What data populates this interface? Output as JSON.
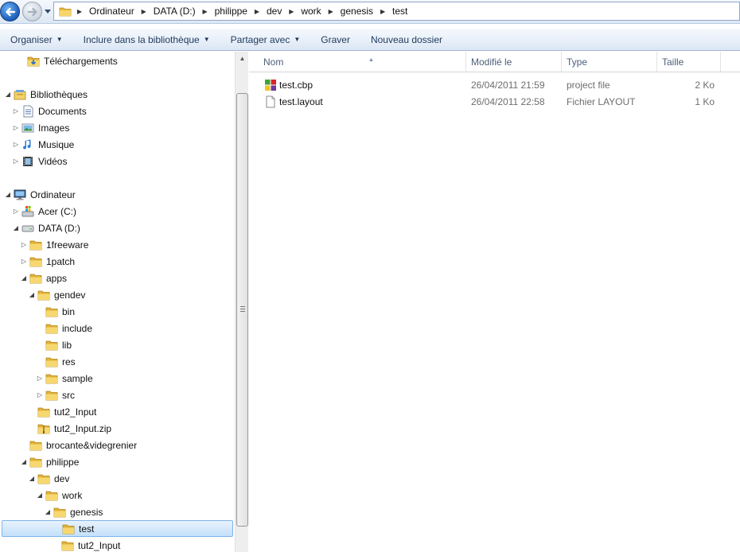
{
  "address_bar": {
    "crumbs": [
      "Ordinateur",
      "DATA (D:)",
      "philippe",
      "dev",
      "work",
      "genesis",
      "test"
    ]
  },
  "toolbar": {
    "organize": "Organiser",
    "include_library": "Inclure dans la bibliothèque",
    "share_with": "Partager avec",
    "burn": "Graver",
    "new_folder": "Nouveau dossier"
  },
  "nav_tree": [
    {
      "label": "Téléchargements",
      "icon": "downloads-folder-icon",
      "expander": "none"
    },
    {
      "label": "Bibliothèques",
      "icon": "libraries-icon",
      "expander": "expanded"
    },
    {
      "label": "Documents",
      "icon": "documents-library-icon",
      "expander": "collapsed"
    },
    {
      "label": "Images",
      "icon": "pictures-library-icon",
      "expander": "collapsed"
    },
    {
      "label": "Musique",
      "icon": "music-library-icon",
      "expander": "collapsed"
    },
    {
      "label": "Vidéos",
      "icon": "videos-library-icon",
      "expander": "collapsed"
    },
    {
      "label": "Ordinateur",
      "icon": "computer-icon",
      "expander": "expanded"
    },
    {
      "label": "Acer (C:)",
      "icon": "system-drive-icon",
      "expander": "collapsed"
    },
    {
      "label": "DATA (D:)",
      "icon": "hard-drive-icon",
      "expander": "expanded"
    },
    {
      "label": "1freeware",
      "icon": "folder-icon",
      "expander": "collapsed"
    },
    {
      "label": "1patch",
      "icon": "folder-icon",
      "expander": "collapsed"
    },
    {
      "label": "apps",
      "icon": "folder-icon",
      "expander": "expanded"
    },
    {
      "label": "gendev",
      "icon": "folder-icon",
      "expander": "expanded"
    },
    {
      "label": "bin",
      "icon": "folder-icon",
      "expander": "none"
    },
    {
      "label": "include",
      "icon": "folder-icon",
      "expander": "none"
    },
    {
      "label": "lib",
      "icon": "folder-icon",
      "expander": "none"
    },
    {
      "label": "res",
      "icon": "folder-icon",
      "expander": "none"
    },
    {
      "label": "sample",
      "icon": "folder-icon",
      "expander": "collapsed"
    },
    {
      "label": "src",
      "icon": "folder-icon",
      "expander": "collapsed"
    },
    {
      "label": "tut2_Input",
      "icon": "folder-icon",
      "expander": "none"
    },
    {
      "label": "tut2_Input.zip",
      "icon": "zip-folder-icon",
      "expander": "none"
    },
    {
      "label": "brocante&videgrenier",
      "icon": "folder-icon",
      "expander": "none"
    },
    {
      "label": "philippe",
      "icon": "folder-icon",
      "expander": "expanded"
    },
    {
      "label": "dev",
      "icon": "folder-icon",
      "expander": "expanded"
    },
    {
      "label": "work",
      "icon": "folder-icon",
      "expander": "expanded"
    },
    {
      "label": "genesis",
      "icon": "folder-icon",
      "expander": "expanded"
    },
    {
      "label": "test",
      "icon": "folder-icon",
      "expander": "none",
      "selected": true
    },
    {
      "label": "tut2_Input",
      "icon": "folder-icon",
      "expander": "none"
    }
  ],
  "columns": {
    "name": "Nom",
    "modified": "Modifié le",
    "type": "Type",
    "size": "Taille"
  },
  "files": [
    {
      "name": "test.cbp",
      "modified": "26/04/2011 21:59",
      "type": "project file",
      "size": "2 Ko",
      "icon": "codeblocks-project-icon"
    },
    {
      "name": "test.layout",
      "modified": "26/04/2011 22:58",
      "type": "Fichier LAYOUT",
      "size": "1 Ko",
      "icon": "generic-file-icon"
    }
  ],
  "colors": {
    "selection_bg": "#c4e0fb",
    "selection_border": "#7eb4ea",
    "folder_yellow": "#f1c94a",
    "toolbar_text": "#1e395b"
  }
}
